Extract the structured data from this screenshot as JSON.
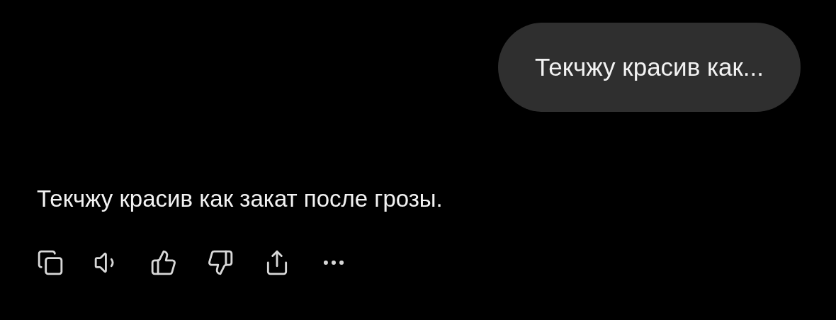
{
  "user_message": {
    "text": "Текчжу красив как..."
  },
  "assistant_message": {
    "text": "Текчжу красив как закат после грозы."
  }
}
